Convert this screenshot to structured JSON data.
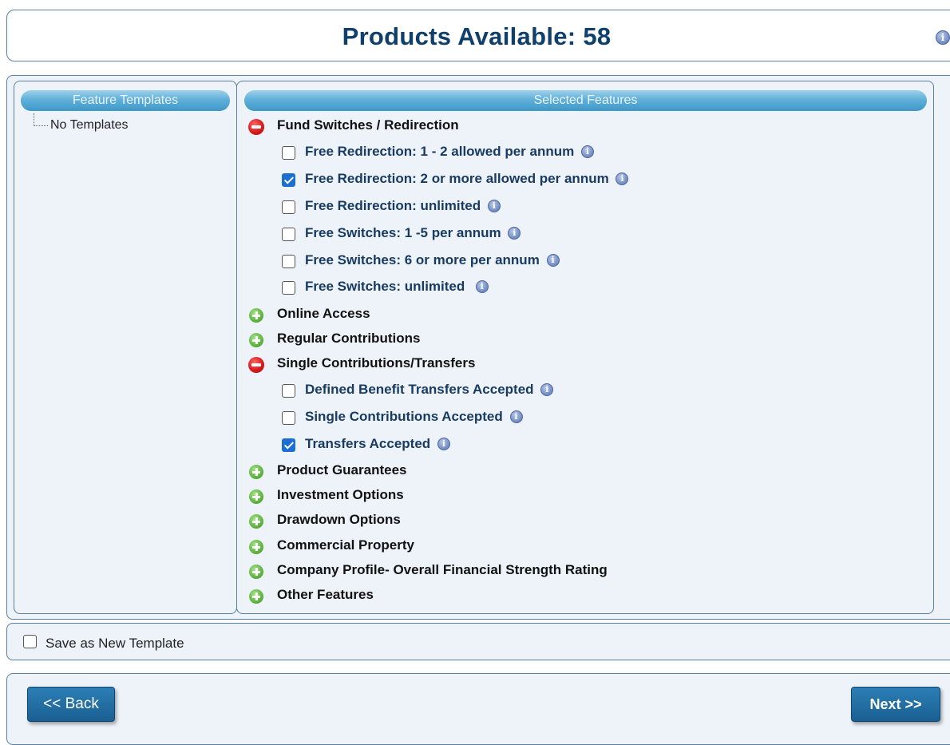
{
  "header": {
    "title": "Products Available: 58",
    "info_icon": "info-icon"
  },
  "templates": {
    "title": "Feature Templates",
    "items": [
      "No Templates"
    ]
  },
  "features": {
    "title": "Selected Features",
    "categories": [
      {
        "label": "Fund Switches / Redirection",
        "expanded": true,
        "items": [
          {
            "label": "Free Redirection: 1 - 2 allowed per annum",
            "checked": false
          },
          {
            "label": "Free Redirection: 2 or more allowed per annum",
            "checked": true
          },
          {
            "label": "Free Redirection: unlimited",
            "checked": false
          },
          {
            "label": "Free Switches: 1 -5 per annum",
            "checked": false
          },
          {
            "label": "Free Switches: 6 or more per annum",
            "checked": false
          },
          {
            "label": "Free Switches: unlimited",
            "checked": false
          }
        ]
      },
      {
        "label": "Online Access",
        "expanded": false
      },
      {
        "label": "Regular Contributions",
        "expanded": false
      },
      {
        "label": "Single Contributions/Transfers",
        "expanded": true,
        "items": [
          {
            "label": "Defined Benefit Transfers Accepted",
            "checked": false
          },
          {
            "label": "Single Contributions Accepted",
            "checked": false
          },
          {
            "label": "Transfers Accepted",
            "checked": true
          }
        ]
      },
      {
        "label": "Product Guarantees",
        "expanded": false
      },
      {
        "label": "Investment Options",
        "expanded": false
      },
      {
        "label": "Drawdown Options",
        "expanded": false
      },
      {
        "label": "Commercial Property",
        "expanded": false
      },
      {
        "label": "Company Profile- Overall Financial Strength Rating",
        "expanded": false
      },
      {
        "label": "Other Features",
        "expanded": false
      }
    ]
  },
  "save_template": {
    "label": "Save as New Template",
    "checked": false
  },
  "nav": {
    "back_label": "<< Back",
    "next_label": "Next >>"
  },
  "colors": {
    "title": "#0f3f6b",
    "accent": "#1c6fd1",
    "panel_bg": "#edf3f9",
    "button": "#1b5f92"
  }
}
